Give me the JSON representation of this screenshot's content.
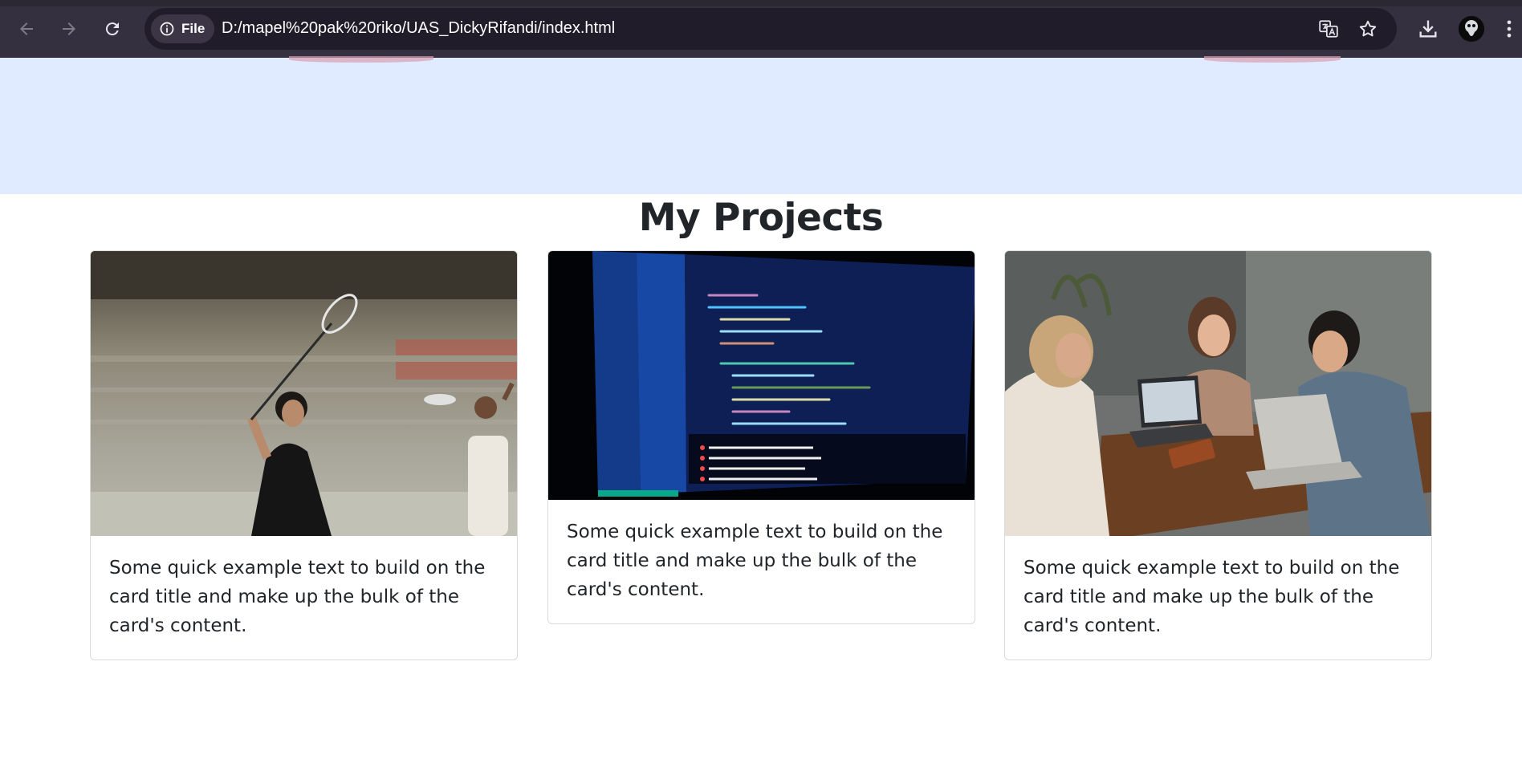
{
  "browser": {
    "security_chip_label": "File",
    "url": "D:/mapel%20pak%20riko/UAS_DickyRifandi/index.html",
    "icons": [
      "back-icon",
      "forward-icon",
      "reload-icon",
      "info-icon",
      "translate-icon",
      "star-icon",
      "download-icon",
      "avatar",
      "menu-icon"
    ]
  },
  "page": {
    "title": "My Projects",
    "cards": [
      {
        "image": "badminton-player-photo",
        "text": "Some quick example text to build on the card title and make up the bulk of the card's content."
      },
      {
        "image": "code-editor-screen-photo",
        "text": "Some quick example text to build on the card title and make up the bulk of the card's content."
      },
      {
        "image": "people-laptop-cafe-photo",
        "text": "Some quick example text to build on the card title and make up the bulk of the card's content."
      }
    ]
  },
  "colors": {
    "chrome_bg": "#35303f",
    "omnibox_bg": "#201c29",
    "hero_bg": "#e0ebff",
    "heading_text": "#212529"
  }
}
